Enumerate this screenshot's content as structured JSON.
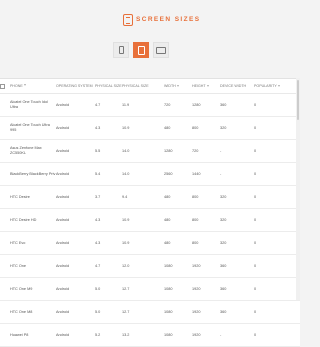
{
  "header": {
    "title": "SCREEN SIZES"
  },
  "device_tabs": [
    {
      "icon": "phone-icon",
      "active": false
    },
    {
      "icon": "tablet-icon",
      "active": true
    },
    {
      "icon": "desktop-icon",
      "active": false
    }
  ],
  "table": {
    "columns": [
      "Phone",
      "Operating System",
      "Physical Size",
      "Physical Size",
      "Width",
      "Height",
      "Device Width",
      "Popularity"
    ],
    "rows": [
      [
        "Alcatel One Touch Idol Ultra",
        "Android",
        "4.7",
        "11.9",
        "720",
        "1280",
        "360",
        "0"
      ],
      [
        "Alcatel One Touch Ultra 995",
        "Android",
        "4.3",
        "10.9",
        "480",
        "800",
        "320",
        "0"
      ],
      [
        "Asus Zenfone Max ZC550KL",
        "Android",
        "5.5",
        "14.0",
        "1280",
        "720",
        "-",
        "0"
      ],
      [
        "BlackBerry BlackBerry Priv",
        "Android",
        "5.4",
        "14.0",
        "2560",
        "1440",
        "-",
        "0"
      ],
      [
        "HTC Desire",
        "Android",
        "3.7",
        "9.4",
        "480",
        "800",
        "320",
        "0"
      ],
      [
        "HTC Desire HD",
        "Android",
        "4.3",
        "10.9",
        "480",
        "800",
        "320",
        "0"
      ],
      [
        "HTC Evo",
        "Android",
        "4.3",
        "10.9",
        "480",
        "800",
        "320",
        "0"
      ],
      [
        "HTC One",
        "Android",
        "4.7",
        "12.0",
        "1080",
        "1920",
        "360",
        "0"
      ],
      [
        "HTC One M9",
        "Android",
        "5.0",
        "12.7",
        "1080",
        "1920",
        "360",
        "0"
      ],
      [
        "HTC One M8",
        "Android",
        "5.0",
        "12.7",
        "1080",
        "1920",
        "360",
        "0"
      ],
      [
        "Huawei P8",
        "Android",
        "5.2",
        "13.2",
        "1080",
        "1920",
        "-",
        "0"
      ]
    ]
  }
}
